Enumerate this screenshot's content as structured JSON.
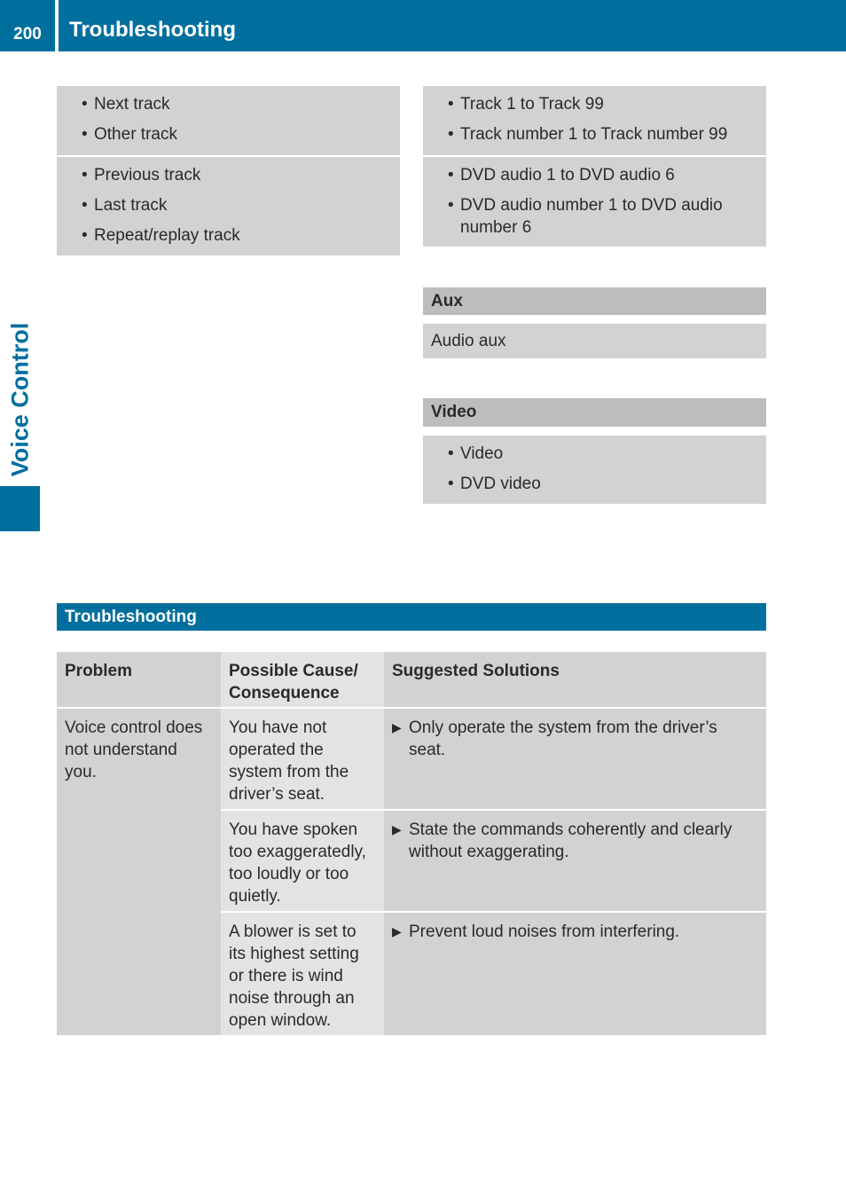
{
  "header": {
    "page_number": "200",
    "title": "Troubleshooting"
  },
  "side_tab": {
    "label": "Voice Control"
  },
  "left_box": {
    "groups": [
      [
        "Next track",
        "Other track"
      ],
      [
        "Previous track",
        "Last track",
        "Repeat/replay track"
      ]
    ]
  },
  "right_box": {
    "groups": [
      [
        "Track 1 to Track 99",
        "Track number 1 to Track number 99"
      ],
      [
        "DVD audio 1 to DVD audio 6",
        "DVD audio number 1 to DVD audio number 6"
      ]
    ]
  },
  "aux": {
    "heading": "Aux",
    "text": "Audio aux"
  },
  "video": {
    "heading": "Video",
    "items": [
      "Video",
      "DVD video"
    ]
  },
  "troubleshooting": {
    "heading": "Troubleshooting",
    "columns": [
      "Problem",
      "Possible Cause/ Consequence",
      "Suggested Solutions"
    ],
    "problem": "Voice control does not understand you.",
    "rows": [
      {
        "cause": "You have not operated the system from the driver’s seat.",
        "solution": "Only operate the system from the driver’s seat."
      },
      {
        "cause": "You have spoken too exaggeratedly, too loudly or too quietly.",
        "solution": "State the commands coherently and clearly without exaggerating."
      },
      {
        "cause": "A blower is set to its highest setting or there is wind noise through an open window.",
        "solution": "Prevent loud noises from interfering."
      }
    ]
  },
  "colors": {
    "brand_blue": "#016f9e",
    "box_gray": "#d2d2d2",
    "heading_gray": "#bdbdbd",
    "light_gray": "#e3e3e3"
  }
}
